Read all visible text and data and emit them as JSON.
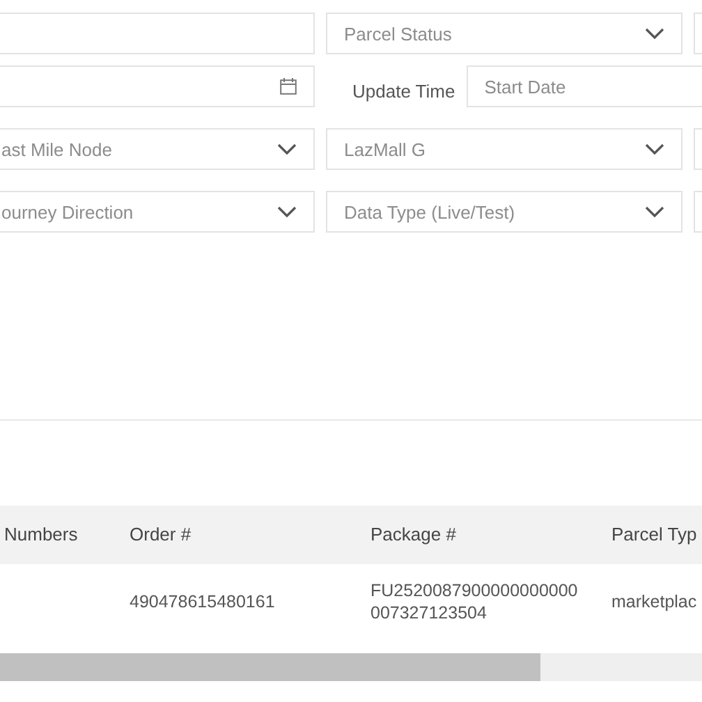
{
  "filters": [
    {
      "kind": "text"
    },
    {
      "kind": "select",
      "placeholder": "Parcel Status"
    },
    {
      "kind": "text"
    },
    {
      "kind": "date"
    },
    {
      "kind": "label",
      "text": "Update Time"
    },
    {
      "kind": "date-start",
      "placeholder": "Start Date"
    },
    {
      "kind": "select",
      "placeholder": "ast Mile Node"
    },
    {
      "kind": "select",
      "placeholder": "LazMall G"
    },
    {
      "kind": "text"
    },
    {
      "kind": "select",
      "placeholder": "ourney Direction"
    },
    {
      "kind": "select",
      "placeholder": "Data Type (Live/Test)"
    },
    {
      "kind": "text"
    }
  ],
  "table": {
    "columns": [
      "Numbers",
      "Order #",
      "Package #",
      "Parcel Typ"
    ],
    "rows": [
      [
        "",
        "490478615480161",
        "FU2520087900000000000007327123504",
        "marketplac"
      ]
    ]
  }
}
